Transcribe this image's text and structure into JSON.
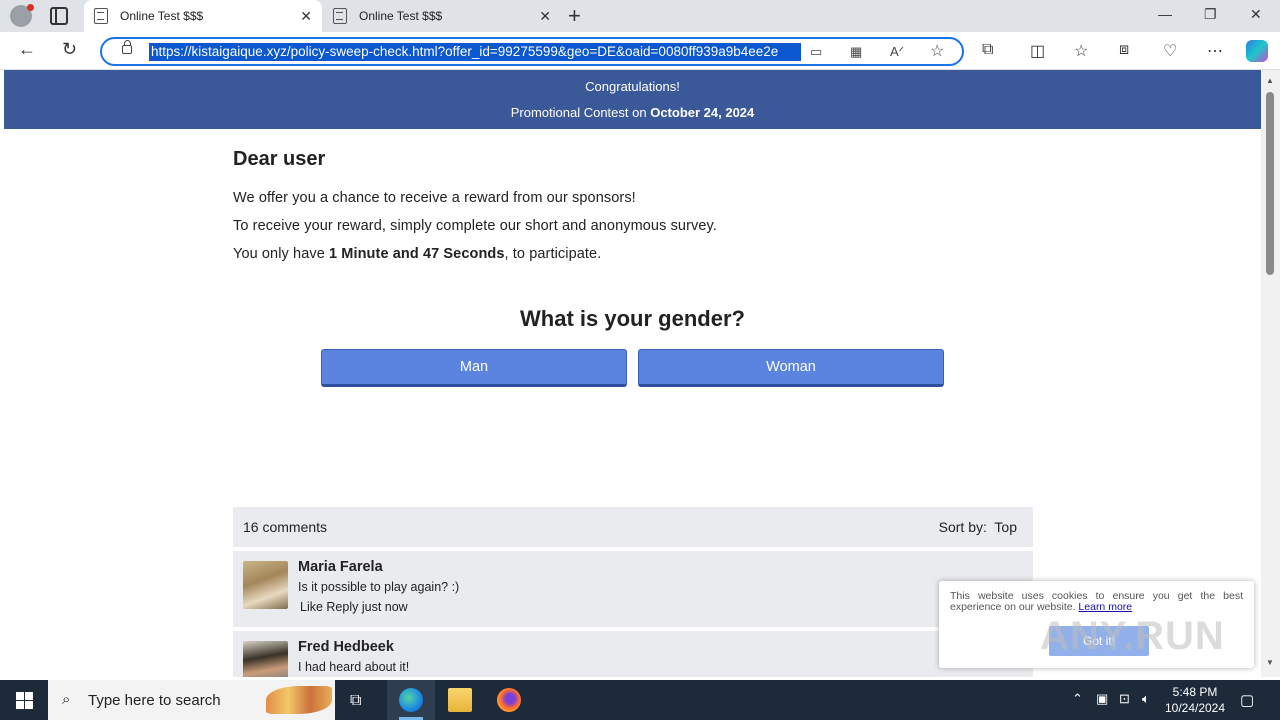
{
  "browser": {
    "tabs": [
      {
        "title": "Online Test $$$",
        "active": true
      },
      {
        "title": "Online Test $$$",
        "active": false
      }
    ],
    "url": "https://kistaigaique.xyz/policy-sweep-check.html?offer_id=99275599&geo=DE&oaid=0080ff939a9b4ee2e"
  },
  "banner": {
    "line1": "Congratulations!",
    "line2_prefix": "Promotional Contest on ",
    "line2_date": "October 24, 2024"
  },
  "content": {
    "greeting": "Dear user",
    "p1": "We offer you a chance to receive a reward from our sponsors!",
    "p2": "To receive your reward, simply complete our short and anonymous survey.",
    "p3_prefix": "You only have ",
    "p3_time": "1 Minute and 47 Seconds",
    "p3_suffix": ", to participate."
  },
  "survey": {
    "question": "What is your gender?",
    "options": [
      "Man",
      "Woman"
    ]
  },
  "comments": {
    "count_label": "16 comments",
    "sort_label": "Sort by:",
    "sort_value": "Top",
    "items": [
      {
        "name": "Maria Farela",
        "text": "Is it possible to play again? :)",
        "meta": "Like Reply  just now"
      },
      {
        "name": "Fred Hedbeek",
        "text": "I had heard about it!",
        "meta": ""
      }
    ]
  },
  "cookie": {
    "text": "This website uses cookies to ensure you get the best experience on our website.",
    "link": "Learn more",
    "button": "Got it!"
  },
  "watermark": "ANY.RUN",
  "taskbar": {
    "search_placeholder": "Type here to search",
    "time": "5:48 PM",
    "date": "10/24/2024"
  }
}
